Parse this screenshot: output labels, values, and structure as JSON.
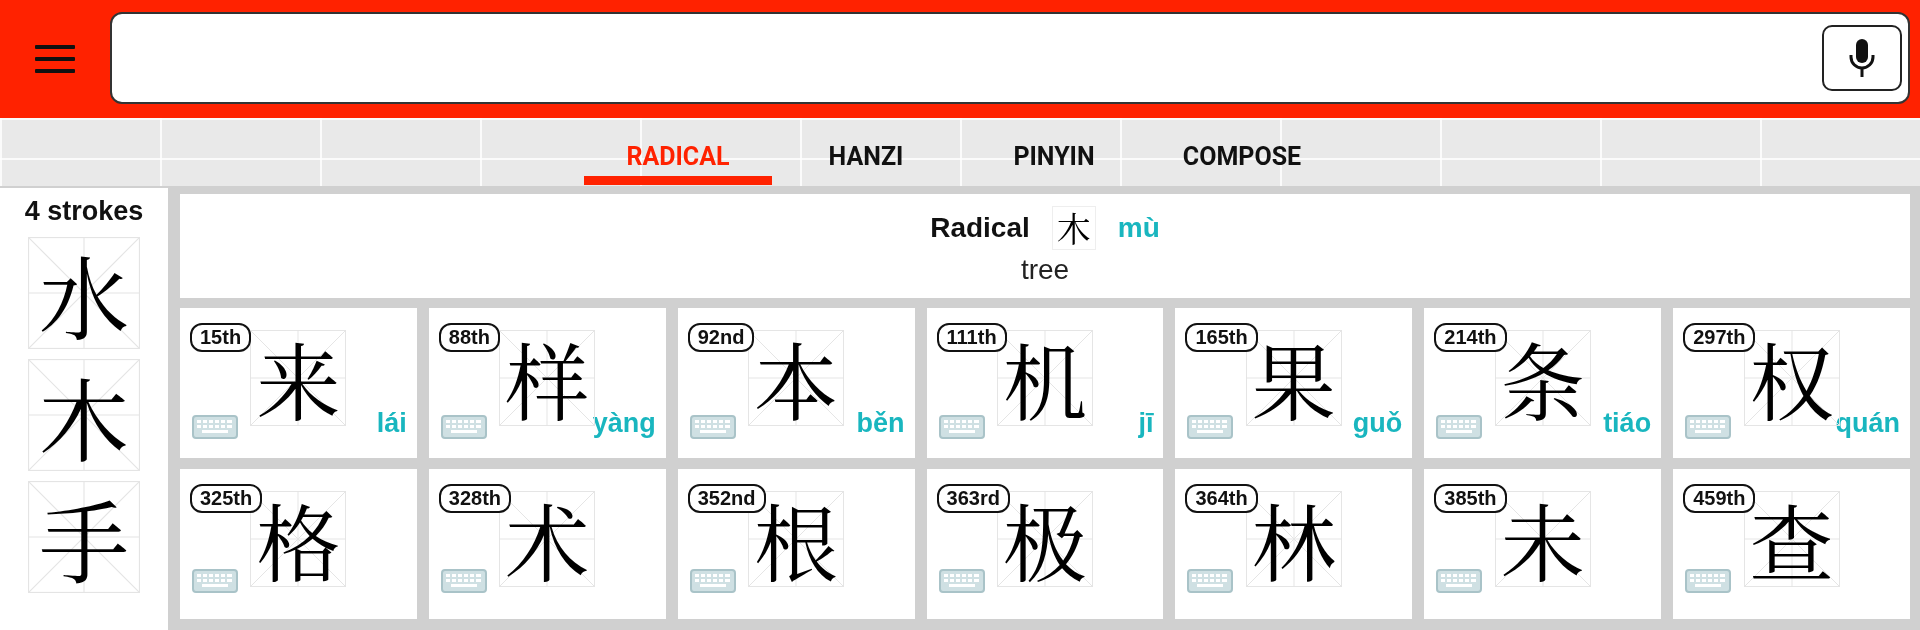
{
  "tabs": [
    {
      "label": "RADICAL",
      "selected": true
    },
    {
      "label": "HANZI",
      "selected": false
    },
    {
      "label": "PINYIN",
      "selected": false
    },
    {
      "label": "COMPOSE",
      "selected": false
    }
  ],
  "strokes_panel": {
    "label": "4 strokes",
    "radicals": [
      {
        "character": "水"
      },
      {
        "character": "木"
      },
      {
        "character": "手"
      }
    ]
  },
  "radical": {
    "label": "Radical",
    "character": "木",
    "pinyin": "mù",
    "meaning": "tree"
  },
  "characters": [
    {
      "rank": "15th",
      "hanzi": "来",
      "pinyin": "lái"
    },
    {
      "rank": "88th",
      "hanzi": "样",
      "pinyin": "yàng"
    },
    {
      "rank": "92nd",
      "hanzi": "本",
      "pinyin": "běn"
    },
    {
      "rank": "111th",
      "hanzi": "机",
      "pinyin": "jī"
    },
    {
      "rank": "165th",
      "hanzi": "果",
      "pinyin": "guǒ"
    },
    {
      "rank": "214th",
      "hanzi": "条",
      "pinyin": "tiáo"
    },
    {
      "rank": "297th",
      "hanzi": "权",
      "pinyin": "quán"
    },
    {
      "rank": "325th",
      "hanzi": "格"
    },
    {
      "rank": "328th",
      "hanzi": "术"
    },
    {
      "rank": "352nd",
      "hanzi": "根"
    },
    {
      "rank": "363rd",
      "hanzi": "极"
    },
    {
      "rank": "364th",
      "hanzi": "林"
    },
    {
      "rank": "385th",
      "hanzi": "未"
    },
    {
      "rank": "459th",
      "hanzi": "查"
    }
  ]
}
